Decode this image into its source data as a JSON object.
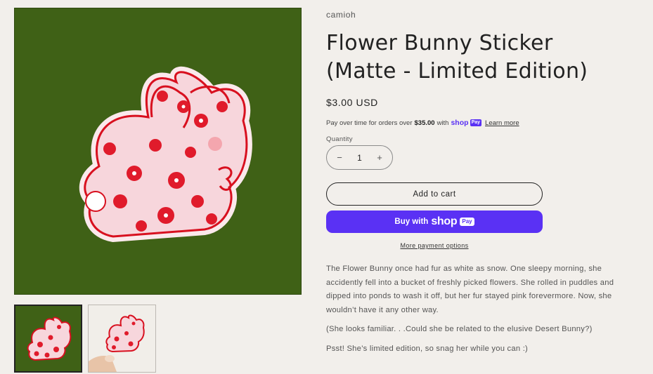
{
  "product": {
    "vendor": "camioh",
    "title": "Flower Bunny Sticker (Matte - Limited Edition)",
    "price": "$3.00 USD"
  },
  "installments": {
    "prefix": "Pay over time for orders over",
    "amount": "$35.00",
    "with": "with",
    "brand": "shop",
    "badge": "Pay",
    "learn_more": "Learn more"
  },
  "quantity": {
    "label": "Quantity",
    "value": "1",
    "decrease": "−",
    "increase": "+"
  },
  "actions": {
    "add_to_cart": "Add to cart",
    "buy_with": "Buy with",
    "buy_brand": "shop",
    "buy_badge": "Pay",
    "more_options": "More payment options"
  },
  "description": [
    "The Flower Bunny once had fur as white as snow. One sleepy morning, she accidently fell into a bucket of freshly picked flowers. She rolled in puddles and dipped into ponds to wash it off, but her fur stayed pink forevermore. Now, she wouldn’t have it any other way.",
    "(She looks familiar. . .Could she be related to the elusive Desert Bunny?)",
    "Psst! She’s limited edition, so snag her while you can :)"
  ],
  "colors": {
    "image_background": "#3f6116",
    "shop_pay": "#5a31f4",
    "sticker_pink": "#f7d6dc",
    "flower_red": "#e01b2b"
  },
  "gallery": {
    "main_alt": "flower bunny sticker on green background",
    "thumbnails": [
      "sticker on green background",
      "sticker held in hand"
    ]
  }
}
